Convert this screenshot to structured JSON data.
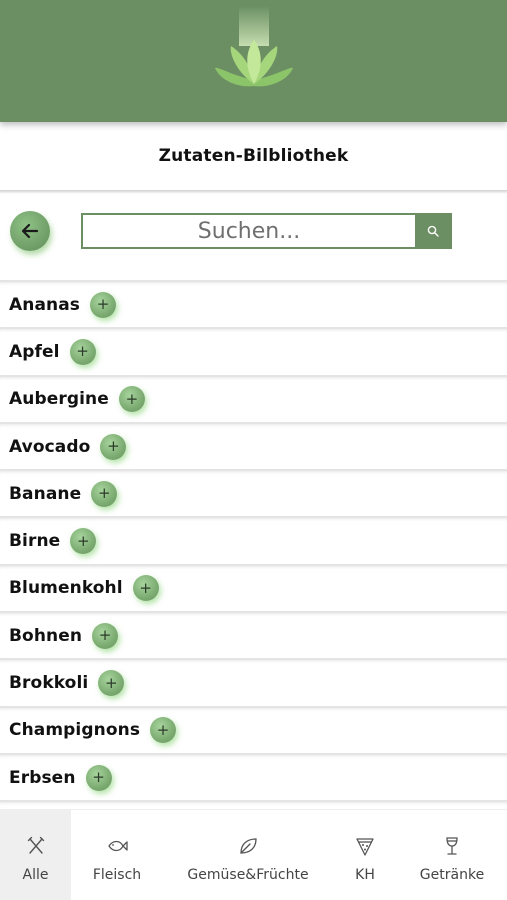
{
  "header": {
    "logo_icon": "lotus-logo-icon",
    "bg_color": "#6b8f63"
  },
  "page_title": "Zutaten-Bilbliothek",
  "search": {
    "placeholder": "Suchen...",
    "value": ""
  },
  "ingredients": [
    {
      "label": "Ananas"
    },
    {
      "label": "Apfel"
    },
    {
      "label": "Aubergine"
    },
    {
      "label": "Avocado"
    },
    {
      "label": "Banane"
    },
    {
      "label": "Birne"
    },
    {
      "label": "Blumenkohl"
    },
    {
      "label": "Bohnen"
    },
    {
      "label": "Brokkoli"
    },
    {
      "label": "Champignons"
    },
    {
      "label": "Erbsen"
    }
  ],
  "add_symbol": "+",
  "bottom_nav": [
    {
      "label": "Alle",
      "icon": "cutlery-icon",
      "active": true
    },
    {
      "label": "Fleisch",
      "icon": "fish-icon",
      "active": false
    },
    {
      "label": "Gemüse&Früchte",
      "icon": "leaf-icon",
      "active": false
    },
    {
      "label": "KH",
      "icon": "pizza-icon",
      "active": false
    },
    {
      "label": "Getränke",
      "icon": "wine-glass-icon",
      "active": false
    }
  ]
}
